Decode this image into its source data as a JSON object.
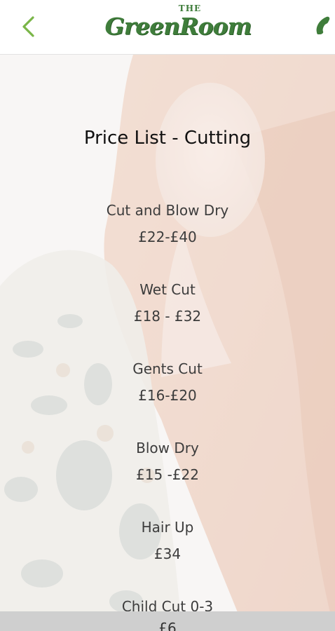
{
  "header": {
    "logo_the": "THE",
    "logo_main": "GreenRoom"
  },
  "colors": {
    "accent": "#7ab648",
    "logo_green": "#3f7d3b",
    "bottom_bar": "#cfcfcf"
  },
  "icons": {
    "back": "chevron-left-icon",
    "call": "phone-icon"
  },
  "page": {
    "title": "Price List - Cutting"
  },
  "items": [
    {
      "name": "Cut and Blow Dry",
      "price": "£22-£40"
    },
    {
      "name": "Wet Cut",
      "price": "£18 - £32"
    },
    {
      "name": "Gents Cut",
      "price": "£16-£20"
    },
    {
      "name": "Blow Dry",
      "price": "£15 -£22"
    },
    {
      "name": "Hair Up",
      "price": "£34"
    },
    {
      "name": "Child Cut 0-3",
      "price": "£6"
    }
  ]
}
